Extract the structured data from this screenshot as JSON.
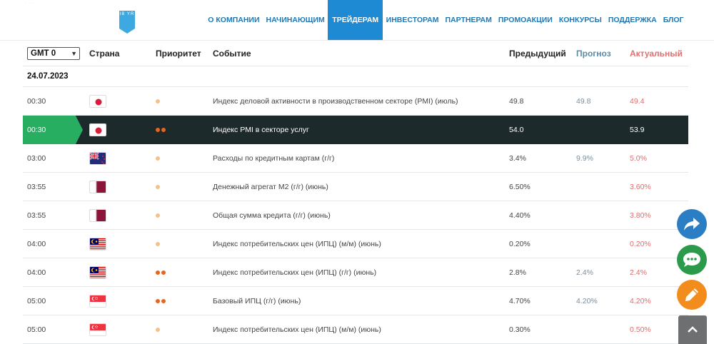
{
  "header": {
    "logo_text": "IB YR",
    "nav": [
      {
        "label": "О компании",
        "active": false
      },
      {
        "label": "Начинающим",
        "active": false
      },
      {
        "label": "Трейдерам",
        "active": true
      },
      {
        "label": "Инвесторам",
        "active": false
      },
      {
        "label": "Партнерам",
        "active": false
      },
      {
        "label": "Промоакции",
        "active": false
      },
      {
        "label": "Конкурсы",
        "active": false
      },
      {
        "label": "Поддержка",
        "active": false
      },
      {
        "label": "Блог",
        "active": false
      }
    ]
  },
  "table": {
    "timezone_select": "GMT 0",
    "columns": {
      "country": "Страна",
      "priority": "Приоритет",
      "event": "Событие",
      "previous": "Предыдущий",
      "forecast": "Прогноз",
      "actual": "Актуальный"
    },
    "date": "24.07.2023",
    "rows": [
      {
        "time": "00:30",
        "flag": "jp-flag-icon",
        "priority": 1,
        "event": "Индекс деловой активности в производственном секторе (PMI) (июль)",
        "previous": "49.8",
        "forecast": "49.8",
        "actual": "49.4"
      },
      {
        "time": "00:30",
        "flag": "jp-flag-icon",
        "priority": 2,
        "event": "Индекс PMI в секторе услуг",
        "previous": "54.0",
        "forecast": "",
        "actual": "53.9"
      },
      {
        "time": "03:00",
        "flag": "nz-flag-icon",
        "priority": 1,
        "event": "Расходы по кредитным картам (г/г)",
        "previous": "3.4%",
        "forecast": "9.9%",
        "actual": "5.0%"
      },
      {
        "time": "03:55",
        "flag": "qa-flag-icon",
        "priority": 1,
        "event": "Денежный агрегат M2 (г/г) (июнь)",
        "previous": "6.50%",
        "forecast": "",
        "actual": "3.60%"
      },
      {
        "time": "03:55",
        "flag": "qa-flag-icon",
        "priority": 1,
        "event": "Общая сумма кредита (г/г) (июнь)",
        "previous": "4.40%",
        "forecast": "",
        "actual": "3.80%"
      },
      {
        "time": "04:00",
        "flag": "my-flag-icon",
        "priority": 1,
        "event": "Индекс потребительских цен (ИПЦ) (м/м) (июнь)",
        "previous": "0.20%",
        "forecast": "",
        "actual": "0.20%"
      },
      {
        "time": "04:00",
        "flag": "my-flag-icon",
        "priority": 2,
        "event": "Индекс потребительских цен (ИПЦ) (г/г) (июнь)",
        "previous": "2.8%",
        "forecast": "2.4%",
        "actual": "2.4%"
      },
      {
        "time": "05:00",
        "flag": "sg-flag-icon",
        "priority": 2,
        "event": "Базовый ИПЦ (г/г) (июнь)",
        "previous": "4.70%",
        "forecast": "4.20%",
        "actual": "4.20%"
      },
      {
        "time": "05:00",
        "flag": "sg-flag-icon",
        "priority": 1,
        "event": "Индекс потребительских цен (ИПЦ) (м/м) (июнь)",
        "previous": "0.30%",
        "forecast": "",
        "actual": "0.50%"
      }
    ],
    "highlight_row": 1
  },
  "colors": {
    "nav_text": "#1f78b4",
    "nav_active_bg": "#1f8ad4",
    "forecast_header": "#5b8aa5",
    "actual": "#e06c6c",
    "highlight_bg": "#1d2a2c",
    "highlight_tag": "#27ae60"
  },
  "floating_buttons": [
    "share-icon",
    "chat-icon",
    "edit-icon",
    "chevron-up-icon"
  ]
}
